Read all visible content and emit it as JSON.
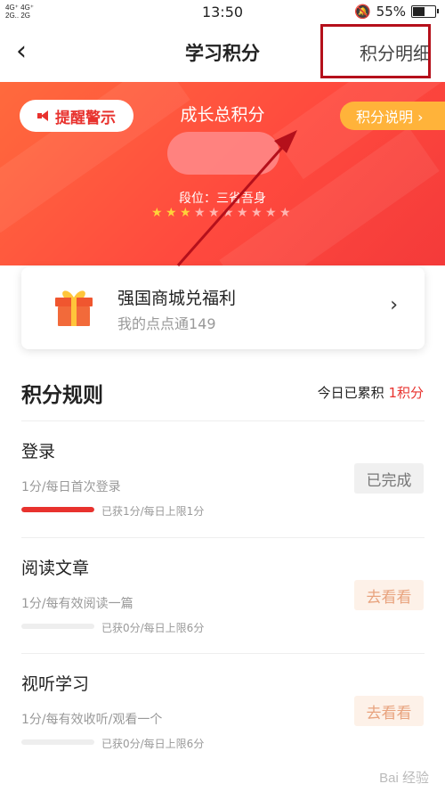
{
  "status_bar": {
    "signal_1": "4G⁺ 4G⁺",
    "signal_2": "2G.. 2G",
    "time": "13:50",
    "battery": "55%",
    "battery_level": 0.55
  },
  "nav": {
    "back_icon": "chevron-left-icon",
    "title": "学习积分",
    "detail_label": "积分明细"
  },
  "banner": {
    "alert_label": "提醒警示",
    "growth_title": "成长总积分",
    "explain_label": "积分说明 ›",
    "rank_text": "段位：三省吾身",
    "stars_total": 10,
    "stars_lit": 3
  },
  "gift": {
    "title": "强国商城兑福利",
    "subtitle": "我的点点通149",
    "chevron": "›"
  },
  "rules": {
    "title": "积分规则",
    "today_prefix": "今日已累积 ",
    "today_value": "1积分"
  },
  "tasks": [
    {
      "name": "登录",
      "rule": "1分/每日首次登录",
      "progress_text": "已获1分/每日上限1分",
      "progress": 1.0,
      "button": "已完成",
      "done": true
    },
    {
      "name": "阅读文章",
      "rule": "1分/每有效阅读一篇",
      "progress_text": "已获0分/每日上限6分",
      "progress": 0.0,
      "button": "去看看",
      "done": false
    },
    {
      "name": "视听学习",
      "rule": "1分/每有效收听/观看一个",
      "progress_text": "已获0分/每日上限6分",
      "progress": 0.0,
      "button": "去看看",
      "done": false
    }
  ],
  "colors": {
    "accent": "#e8322e",
    "banner": "#ff5a3c",
    "explain": "#ffb33a",
    "annotation": "#b5101b"
  },
  "watermark": "Bai 经验"
}
